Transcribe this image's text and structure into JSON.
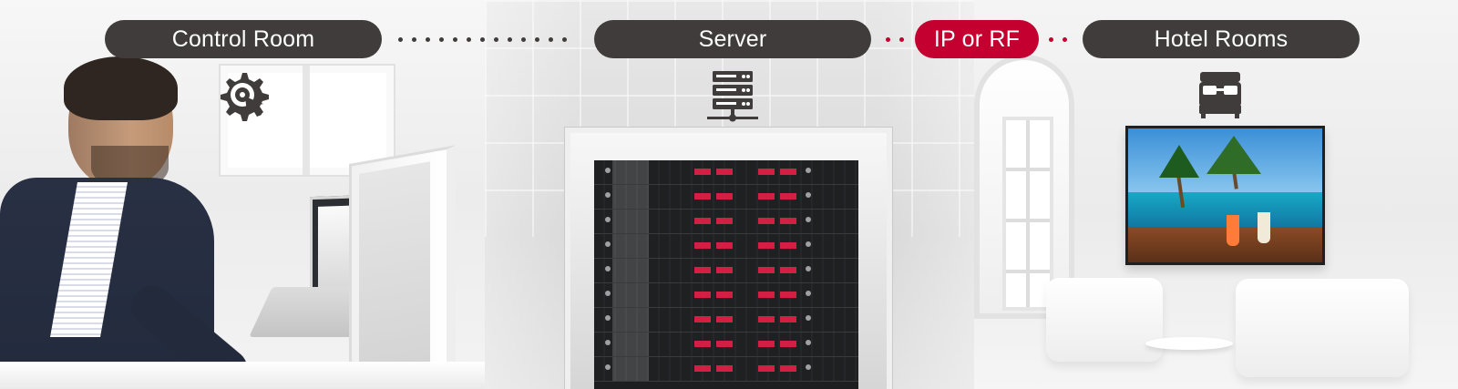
{
  "labels": {
    "control_room": "Control Room",
    "server": "Server",
    "ip_or_rf": "IP or RF",
    "hotel_rooms": "Hotel Rooms"
  },
  "colors": {
    "dark_pill": "#403c3c",
    "accent_red": "#c3002f"
  },
  "icons": {
    "control_room": "gear-cursor-icon",
    "server": "server-stack-icon",
    "hotel_rooms": "bed-icon"
  }
}
